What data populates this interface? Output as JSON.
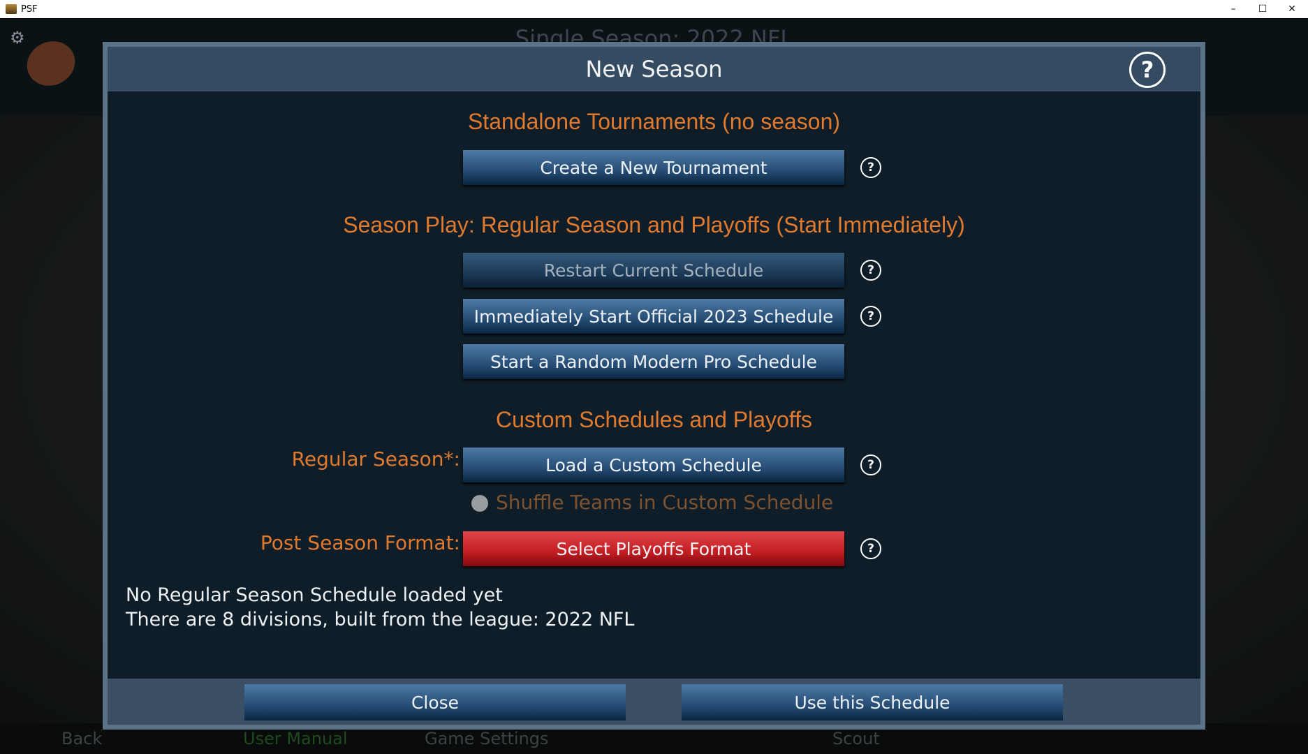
{
  "window": {
    "title": "PSF",
    "minimize": "–",
    "maximize": "☐",
    "close": "✕"
  },
  "background": {
    "title": "Single Season: 2022 NFL",
    "logo": "Pro Football",
    "nav": [
      "Back",
      "User Manual",
      "Game Settings",
      "Scout"
    ]
  },
  "modal": {
    "title": "New Season",
    "sections": {
      "standalone": "Standalone Tournaments (no season)",
      "season_play": "Season Play: Regular Season and Playoffs (Start Immediately)",
      "custom": "Custom Schedules and Playoffs"
    },
    "buttons": {
      "create_tournament": "Create a New Tournament",
      "restart": "Restart Current Schedule",
      "official": "Immediately Start Official 2023 Schedule",
      "random": "Start a Random Modern Pro Schedule",
      "load_custom": "Load a Custom Schedule",
      "playoffs": "Select Playoffs Format",
      "close": "Close",
      "use": "Use this Schedule"
    },
    "labels": {
      "regular_season": "Regular Season*:",
      "post_season": "Post Season Format:"
    },
    "shuffle": {
      "label": "Shuffle Teams in Custom Schedule",
      "checked": false,
      "disabled": true
    },
    "status": [
      "No Regular Season Schedule loaded yet",
      "There are 8 divisions, built from the league: 2022 NFL"
    ],
    "help": "?"
  },
  "colors": {
    "accent": "#e07a2e",
    "button": "#254c74",
    "danger": "#c21d22"
  }
}
